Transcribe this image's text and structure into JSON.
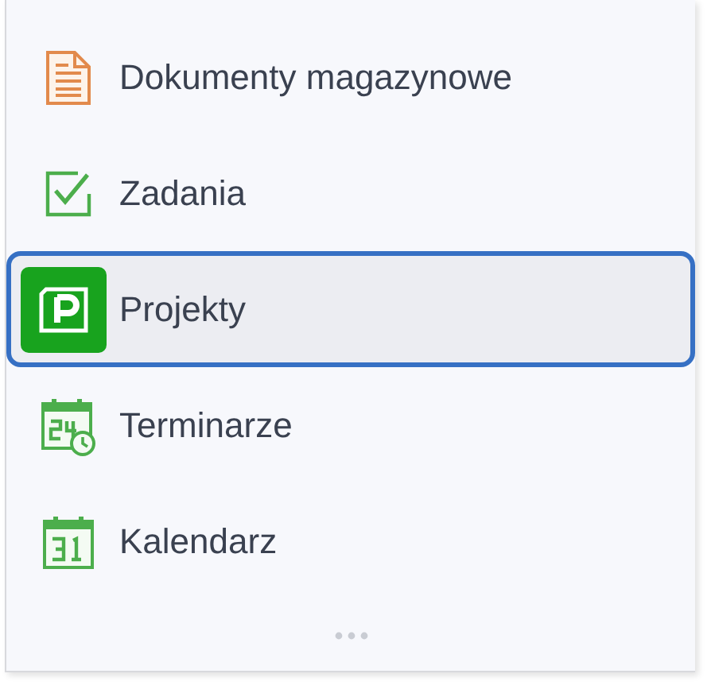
{
  "menu": {
    "items": [
      {
        "label": "Dokumenty magazynowe",
        "kind": "document",
        "selected": false
      },
      {
        "label": "Zadania",
        "kind": "tasks",
        "selected": false
      },
      {
        "label": "Projekty",
        "kind": "project",
        "selected": true
      },
      {
        "label": "Terminarze",
        "kind": "schedule",
        "selected": false
      },
      {
        "label": "Kalendarz",
        "kind": "calendar",
        "selected": false
      }
    ]
  }
}
